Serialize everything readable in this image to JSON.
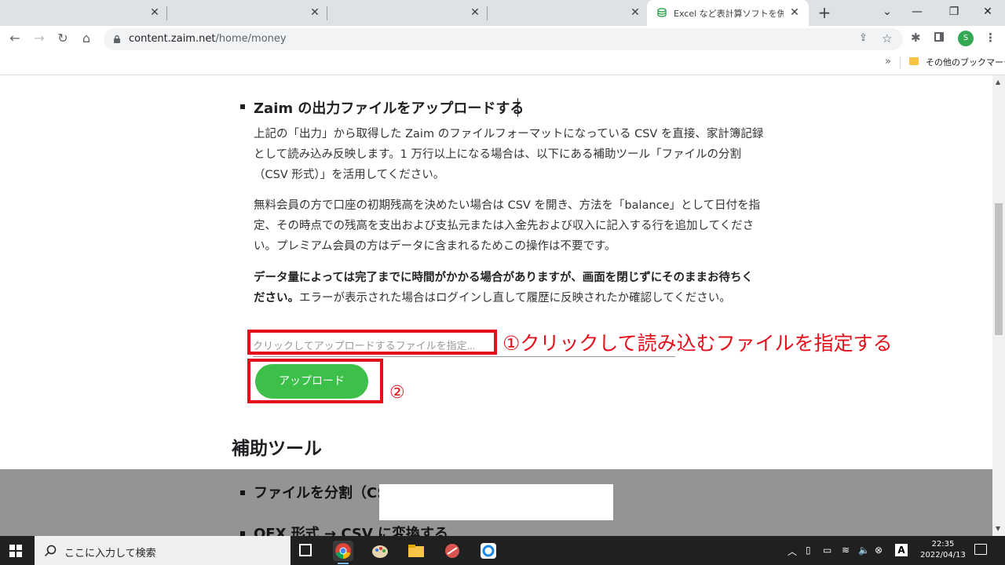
{
  "browser": {
    "active_tab_title": "Excel など表計算ソフトを併用し",
    "url_host": "content.zaim.net",
    "url_path": "/home/money",
    "avatar_initial": "S",
    "bookmarks_other_label": "その他のブックマーク"
  },
  "content": {
    "upload_heading": "Zaim の出力ファイルをアップロードする",
    "para1": "上記の「出力」から取得した Zaim のファイルフォーマットになっている CSV を直接、家計簿記録として読み込み反映します。1 万行以上になる場合は、以下にある補助ツール「ファイルの分割（CSV 形式）」を活用してください。",
    "para2": "無料会員の方で口座の初期残高を決めたい場合は CSV を開き、方法を「balance」として日付を指定、その時点での残高を支出および支払元または入金先および収入に記入する行を追加してください。プレミアム会員の方はデータに含まれるためこの操作は不要です。",
    "para3_bold": "データ量によっては完了までに時間がかかる場合がありますが、画面を閉じずにそのままお待ちください。",
    "para3_rest": "エラーが表示された場合はログインし直して履歴に反映されたか確認してください。",
    "file_input_placeholder": "クリックしてアップロードするファイルを指定...",
    "upload_button": "アップロード",
    "annotation1": "①クリックして読み込むファイルを指定する",
    "annotation2": "②",
    "tools_heading": "補助ツール",
    "tool_item1": "ファイルを分割（CS",
    "tool_item2": "OFX 形式 → CSV に変換する"
  },
  "taskbar": {
    "search_placeholder": "ここに入力して検索",
    "time": "22:35",
    "date": "2022/04/13"
  },
  "colors": {
    "annotation_red": "#e3101b",
    "upload_green": "#3cc04a"
  }
}
